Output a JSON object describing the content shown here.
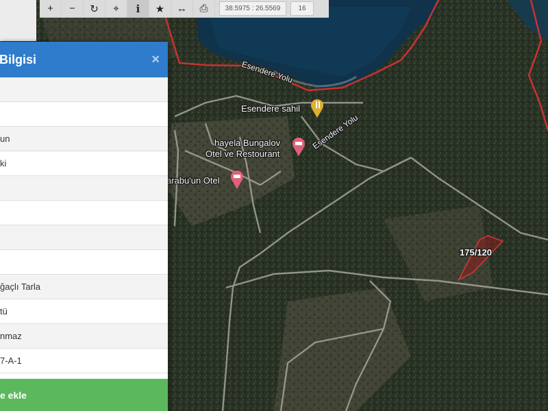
{
  "toolbar": {
    "buttons": [
      {
        "name": "zoom-in",
        "glyph": "+"
      },
      {
        "name": "zoom-out",
        "glyph": "−"
      },
      {
        "name": "refresh",
        "glyph": "↻"
      },
      {
        "name": "locate",
        "glyph": "⌖"
      },
      {
        "name": "info",
        "glyph": "i"
      },
      {
        "name": "favorite",
        "glyph": "★"
      },
      {
        "name": "measure",
        "glyph": "↔"
      },
      {
        "name": "print",
        "glyph": "⎙"
      }
    ],
    "coordinates": "38.5975 : 26.5569",
    "zoom_level": "16"
  },
  "panel": {
    "title": "Bilgisi",
    "close_glyph": "×",
    "rows": [
      "",
      "",
      "un",
      "ki",
      "",
      "",
      "",
      "",
      "ğaçlı Tarla",
      "tü",
      "nmaz",
      "7-A-1"
    ],
    "action_label": "e ekle"
  },
  "map": {
    "labels": {
      "road_esendere_1": "Esendere Yolu",
      "road_esendere_2": "Esendere Yolu",
      "poi_beach": "Esendere sahil",
      "poi_bungalov_line1": "hayela Bungalov",
      "poi_bungalov_line2": "Otel ve Restourant",
      "poi_otel": "arabu'un Otel",
      "parcel": "175/120"
    },
    "colors": {
      "boundary": "#c83232",
      "parcel_fill": "#8c1e1e",
      "poi_pink": "#e0607a",
      "poi_yellow": "#e0b030"
    }
  }
}
